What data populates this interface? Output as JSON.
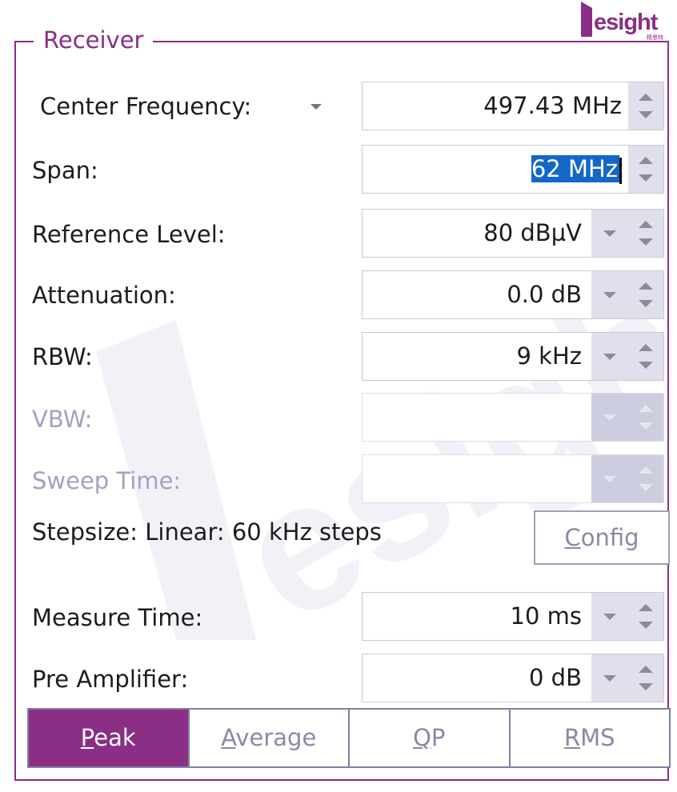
{
  "group": {
    "title": "Receiver"
  },
  "logo": {
    "text": "esight",
    "sub": "精思特"
  },
  "rows": {
    "center_frequency": {
      "label": "Center Frequency:",
      "value": "497.43 MHz"
    },
    "span": {
      "label": "Span:",
      "value": "62 MHz"
    },
    "reference_level": {
      "label": "Reference Level:",
      "value": "80 dBµV"
    },
    "attenuation": {
      "label": "Attenuation:",
      "value": "0.0 dB"
    },
    "rbw": {
      "label": "RBW:",
      "value": "9 kHz"
    },
    "vbw": {
      "label": "VBW:",
      "value": ""
    },
    "sweep_time": {
      "label": "Sweep Time:",
      "value": ""
    },
    "measure_time": {
      "label": "Measure Time:",
      "value": "10 ms"
    },
    "pre_amplifier": {
      "label": "Pre Amplifier:",
      "value": "0 dB"
    }
  },
  "stepsize": {
    "text": "Stepsize: Linear: 60 kHz steps"
  },
  "config_button": {
    "first": "C",
    "rest": "onfig"
  },
  "detector_tabs": [
    {
      "first": "P",
      "rest": "eak",
      "active": true
    },
    {
      "first": "A",
      "rest": "verage",
      "active": false
    },
    {
      "first": "Q",
      "rest": "P",
      "active": false
    },
    {
      "first": "R",
      "rest": "MS",
      "active": false
    }
  ],
  "colors": {
    "accent": "#8a2e86",
    "selection": "#1467c8",
    "button_face": "#e0e0ec"
  },
  "icons": [
    "dropdown-arrow-icon",
    "spin-up-icon",
    "spin-down-icon",
    "tesight-logo-icon"
  ]
}
